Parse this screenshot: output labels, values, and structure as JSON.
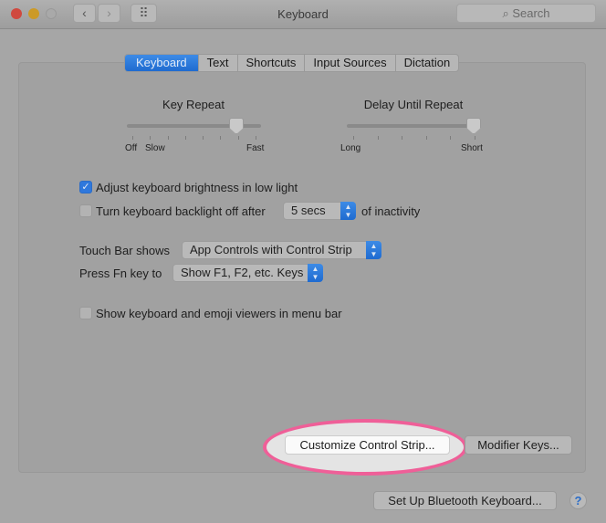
{
  "window": {
    "title": "Keyboard",
    "search_placeholder": "Search",
    "back": "‹",
    "forward": "›",
    "grid": "⠿"
  },
  "tabs": [
    {
      "label": "Keyboard",
      "active": true
    },
    {
      "label": "Text"
    },
    {
      "label": "Shortcuts"
    },
    {
      "label": "Input Sources"
    },
    {
      "label": "Dictation"
    }
  ],
  "key_repeat": {
    "label": "Key Repeat",
    "min_label": "Off",
    "slow_label": "Slow",
    "max_label": "Fast",
    "level_fraction": 0.86
  },
  "delay_until_repeat": {
    "label": "Delay Until Repeat",
    "min_label": "Long",
    "max_label": "Short",
    "level_fraction": 1.0
  },
  "adjust_brightness": {
    "label": "Adjust keyboard brightness in low light",
    "checked": true
  },
  "backlight_off": {
    "label": "Turn keyboard backlight off after",
    "checked": false,
    "value": "5 secs",
    "suffix": "of inactivity"
  },
  "touch_bar": {
    "label": "Touch Bar shows",
    "value": "App Controls with Control Strip"
  },
  "fn_key": {
    "label": "Press Fn key to",
    "value": "Show F1, F2, etc. Keys"
  },
  "show_viewers": {
    "label": "Show keyboard and emoji viewers in menu bar",
    "checked": false
  },
  "buttons": {
    "customize": "Customize Control Strip...",
    "modifier": "Modifier Keys...",
    "bluetooth": "Set Up Bluetooth Keyboard...",
    "help": "?"
  },
  "colors": {
    "accent": "#1f6bd0",
    "highlight": "#ef5f98"
  }
}
